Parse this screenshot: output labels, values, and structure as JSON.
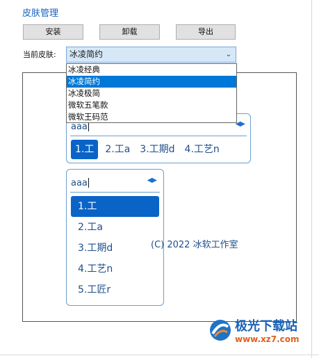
{
  "header": {
    "title": "皮肤管理"
  },
  "toolbar": {
    "install_label": "安装",
    "uninstall_label": "卸载",
    "export_label": "导出"
  },
  "skin": {
    "label": "当前皮肤:",
    "selected": "冰凌简约",
    "options": [
      "冰凌经典",
      "冰凌简约",
      "冰凌极简",
      "微软五笔款",
      "微软王码范"
    ],
    "selected_index": 1
  },
  "preview": {
    "input_text": "aaa",
    "nav_icon": "left-right-arrows",
    "horizontal_candidates": [
      "1.工",
      "2.工a",
      "3.工期d",
      "4.工艺n"
    ],
    "vertical_candidates": [
      "1.工",
      "2.工a",
      "3.工期d",
      "4.工艺n",
      "5.工匠r"
    ],
    "copyright": "(C) 2022 冰软工作室"
  },
  "watermark": {
    "name": "极光下载站",
    "url": "www.xz7.com"
  },
  "colors": {
    "accent": "#0a64c8",
    "selection": "#0078d7",
    "title": "#1565c0"
  }
}
